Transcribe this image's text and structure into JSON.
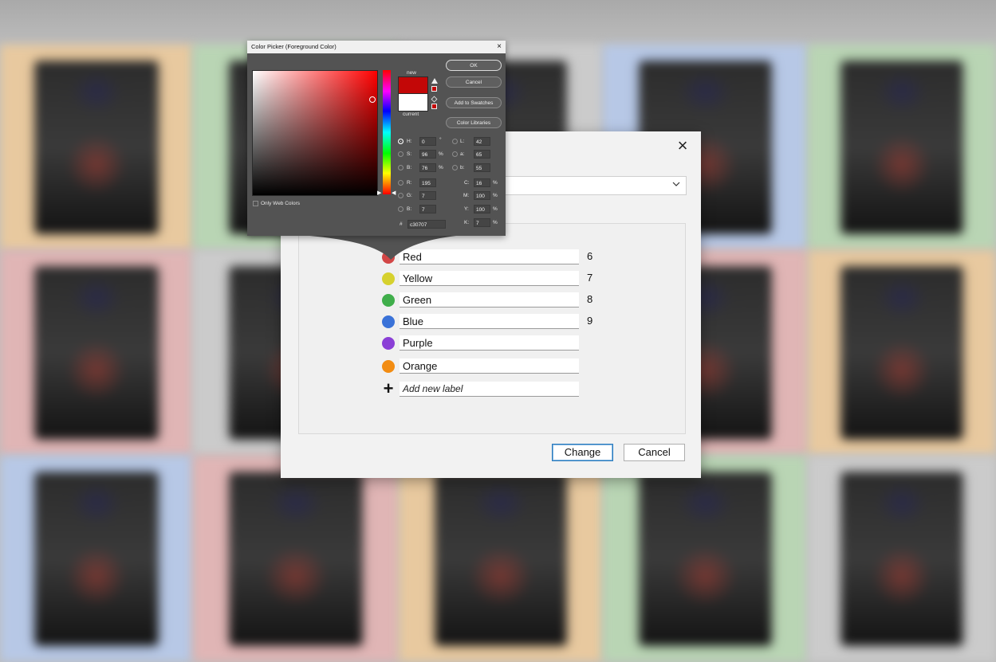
{
  "background": {
    "tiles": [
      {
        "color": "#e8c99f"
      },
      {
        "color": "#b9d5b4"
      },
      {
        "color": "#cbcbcb"
      },
      {
        "color": "#b7c8e6"
      },
      {
        "color": "#b9d5b4"
      },
      {
        "color": "#e0b5b5"
      },
      {
        "color": "#cbcbcb"
      },
      {
        "color": "#b9d5b4"
      },
      {
        "color": "#e0b5b5"
      },
      {
        "color": "#e8c99f"
      },
      {
        "color": "#b7c8e6"
      },
      {
        "color": "#e0b5b5"
      },
      {
        "color": "#e8c99f"
      },
      {
        "color": "#b9d5b4"
      },
      {
        "color": "#cbcbcb"
      }
    ]
  },
  "label_dialog": {
    "close_icon": "×",
    "labels": [
      {
        "name": "Red",
        "color": "#d24646",
        "number": "6"
      },
      {
        "name": "Yellow",
        "color": "#d6d12e",
        "number": "7"
      },
      {
        "name": "Green",
        "color": "#3fae4a",
        "number": "8"
      },
      {
        "name": "Blue",
        "color": "#3a72d8",
        "number": "9"
      },
      {
        "name": "Purple",
        "color": "#8a3fd6",
        "number": ""
      },
      {
        "name": "Orange",
        "color": "#f28c12",
        "number": ""
      }
    ],
    "add_placeholder": "Add new label",
    "change_label": "Change",
    "cancel_label": "Cancel",
    "accent": "#2a7bbf"
  },
  "color_picker": {
    "title": "Color Picker (Foreground Color)",
    "close": "×",
    "new_label": "new",
    "current_label": "current",
    "new_color": "#c30707",
    "current_color": "#ffffff",
    "buttons": {
      "ok": "OK",
      "cancel": "Cancel",
      "add_swatches": "Add to Swatches",
      "libraries": "Color Libraries"
    },
    "only_web_colors": "Only Web Colors",
    "hsb": {
      "h": "0",
      "s": "96",
      "b": "76"
    },
    "rgb": {
      "r": "195",
      "g": "7",
      "b": "7"
    },
    "lab": {
      "l": "42",
      "a": "65",
      "b": "55"
    },
    "cmyk": {
      "c": "16",
      "m": "100",
      "y": "100",
      "k": "7"
    },
    "hex": "c30707",
    "labels": {
      "h": "H:",
      "s": "S:",
      "b": "B:",
      "r": "R:",
      "g": "G:",
      "bb": "B:",
      "l": "L:",
      "a": "a:",
      "lb": "b:",
      "c": "C:",
      "m": "M:",
      "y": "Y:",
      "k": "K:",
      "hash": "#"
    },
    "units": {
      "deg": "°",
      "pct": "%"
    }
  }
}
